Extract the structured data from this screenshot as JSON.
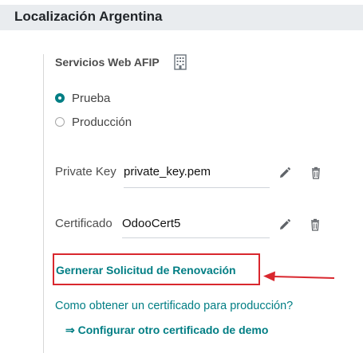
{
  "section": {
    "title": "Localización Argentina"
  },
  "afip": {
    "subtitle": "Servicios Web AFIP",
    "environment_options": [
      {
        "label": "Prueba",
        "checked": true
      },
      {
        "label": "Producción",
        "checked": false
      }
    ]
  },
  "fields": {
    "private_key": {
      "label": "Private Key",
      "value": "private_key.pem"
    },
    "certificate": {
      "label": "Certificado",
      "value": "OdooCert5"
    }
  },
  "links": {
    "renew": "Gernerar Solicitud de Renovación",
    "production_cert": "Como obtener un certificado para producción?",
    "demo_cert": "⇒ Configurar otro certificado de demo"
  },
  "colors": {
    "accent": "#017e84",
    "highlight": "#d9272e",
    "header_bg": "#e9ecef"
  },
  "icons": {
    "company": "building-icon",
    "edit": "pencil-icon",
    "delete": "trash-icon",
    "annotation": "arrow-left-icon"
  }
}
